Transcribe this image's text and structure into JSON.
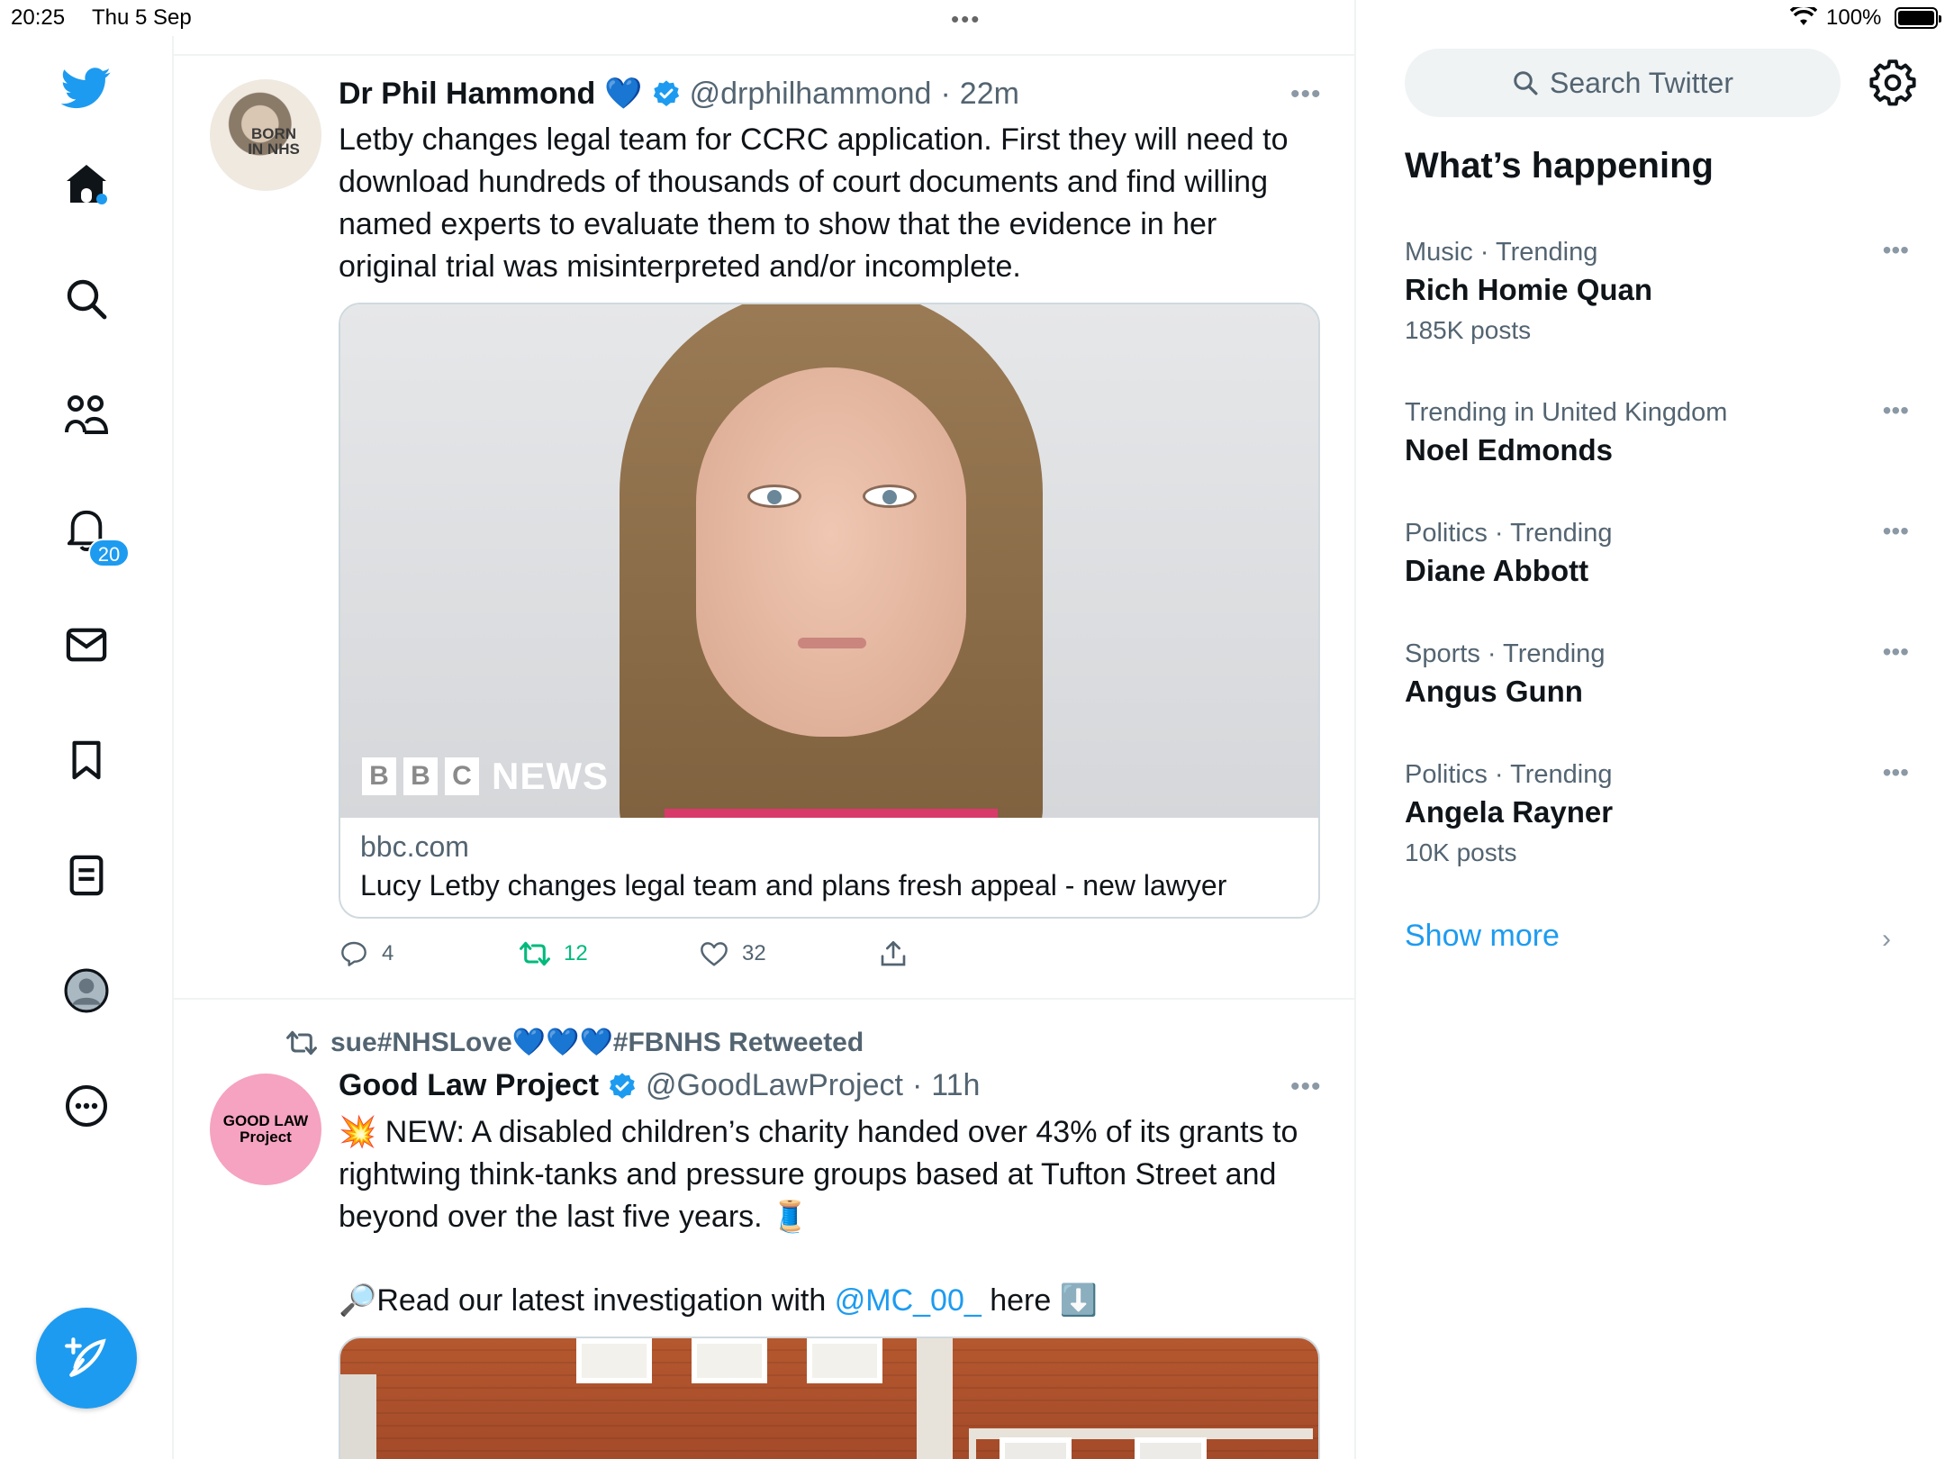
{
  "status_bar": {
    "time": "20:25",
    "date": "Thu 5 Sep",
    "battery": "100%"
  },
  "nav": {
    "notifications_badge": "20"
  },
  "tweets": [
    {
      "name": "Dr Phil Hammond",
      "emoji": "💙",
      "handle": "@drphilhammond",
      "sep": "·",
      "time": "22m",
      "text_lines": [
        "Letby changes legal team for CCRC application. First they will need to",
        "download hundreds of thousands of court documents and find willing",
        "named experts to evaluate them to show that the evidence in her",
        "original trial was misinterpreted and/or incomplete."
      ],
      "avatar_text": "BORN\nIN NHS",
      "card": {
        "watermark": [
          "B",
          "B",
          "C",
          "NEWS"
        ],
        "domain": "bbc.com",
        "title": "Lucy Letby changes legal team and plans fresh appeal - new lawyer"
      },
      "actions": {
        "replies": "4",
        "retweets": "12",
        "likes": "32"
      }
    },
    {
      "retweeted_by": "sue#NHSLove💙💙💙#FBNHS Retweeted",
      "name": "Good Law Project",
      "handle": "@GoodLawProject",
      "sep": "·",
      "time": "11h",
      "avatar_text": "GOOD LAW\nProject",
      "text_lines": [
        "💥 NEW: A disabled children’s charity handed over 43% of its grants to",
        "rightwing think-tanks and pressure groups based at Tufton Street and",
        "beyond over the last five years. 🧵"
      ],
      "line2_prefix": "🔎Read our latest investigation with ",
      "line2_mention": "@MC_00_",
      "line2_suffix": " here ⬇️"
    }
  ],
  "sidebar": {
    "search_placeholder": "Search Twitter",
    "title": "What’s happening",
    "trends": [
      {
        "context": "Music · Trending",
        "title": "Rich Homie Quan",
        "count": "185K posts"
      },
      {
        "context": "Trending in United Kingdom",
        "title": "Noel Edmonds",
        "count": ""
      },
      {
        "context": "Politics · Trending",
        "title": "Diane Abbott",
        "count": ""
      },
      {
        "context": "Sports · Trending",
        "title": "Angus Gunn",
        "count": ""
      },
      {
        "context": "Politics · Trending",
        "title": "Angela Rayner",
        "count": "10K posts"
      }
    ],
    "show_more": "Show more"
  },
  "colors": {
    "accent": "#1d9bf0",
    "retweet_green": "#00ba7c",
    "text_secondary": "#536471"
  },
  "icons": [
    "twitter-bird-icon",
    "home-icon",
    "search-icon",
    "communities-icon",
    "bell-icon",
    "mail-icon",
    "bookmark-icon",
    "lists-icon",
    "profile-icon",
    "more-circle-icon",
    "compose-icon",
    "reply-icon",
    "retweet-icon",
    "like-icon",
    "share-icon",
    "verified-icon",
    "gear-icon",
    "chevron-right-icon"
  ]
}
